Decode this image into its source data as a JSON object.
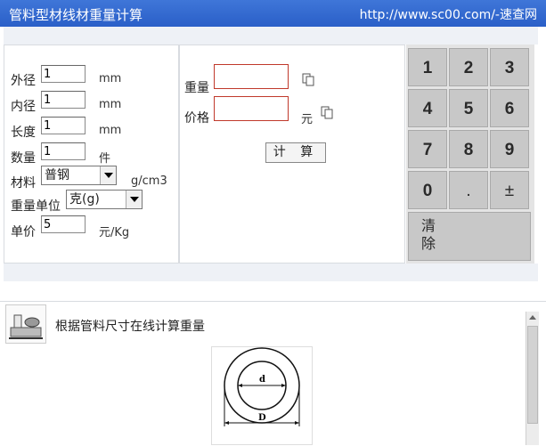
{
  "title": "管料型材线材重量计算",
  "url": "http://www.sc00.com/-速查网",
  "form": {
    "outer_diameter": {
      "label": "外径",
      "value": "1",
      "unit": "mm"
    },
    "inner_diameter": {
      "label": "内径",
      "value": "1",
      "unit": "mm"
    },
    "length": {
      "label": "长度",
      "value": "1",
      "unit": "mm"
    },
    "quantity": {
      "label": "数量",
      "value": "1",
      "unit": "件"
    },
    "material": {
      "label": "材料",
      "selected": "普钢",
      "unit": "g/cm3"
    },
    "weight_unit": {
      "label": "重量单位",
      "selected": "克(g)"
    },
    "unit_price": {
      "label": "单价",
      "value": "5",
      "unit": "元/Kg"
    }
  },
  "result": {
    "weight_label": "重量",
    "price_label": "价格",
    "price_unit": "元",
    "calc_button": "计 算"
  },
  "keypad": {
    "keys": [
      "1",
      "2",
      "3",
      "4",
      "5",
      "6",
      "7",
      "8",
      "9",
      "0",
      ".",
      "±"
    ],
    "clear_line1": "清",
    "clear_line2": "除"
  },
  "info": {
    "description": "根据管料尺寸在线计算重量",
    "diagram_inner": "d",
    "diagram_outer": "D"
  },
  "colors": {
    "title_bar": "#2f66d0",
    "keypad_bg": "#e4e4e4",
    "error_border": "#c0392b"
  }
}
